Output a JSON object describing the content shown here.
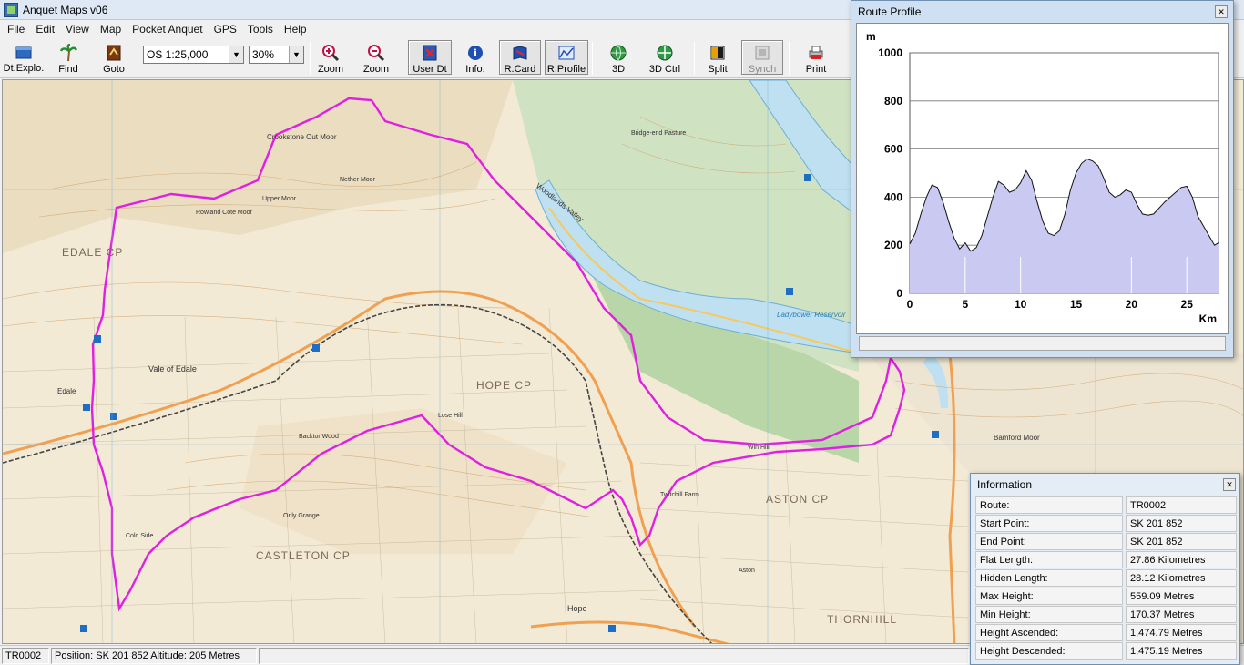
{
  "window": {
    "title": "Anquet Maps v06"
  },
  "menu": [
    "File",
    "Edit",
    "View",
    "Map",
    "Pocket Anquet",
    "GPS",
    "Tools",
    "Help"
  ],
  "toolbar": {
    "buttons": {
      "dt_explo": "Dt.Explo.",
      "find": "Find",
      "goto": "Goto",
      "zoom_in": "Zoom",
      "zoom_out": "Zoom",
      "user_dt": "User Dt",
      "info": "Info.",
      "r_card": "R.Card",
      "r_profile": "R.Profile",
      "three_d": "3D",
      "three_d_ctrl": "3D Ctrl",
      "split": "Split",
      "synch": "Synch",
      "print": "Print"
    },
    "scale_value": "OS 1:25,000",
    "zoom_value": "30%"
  },
  "map": {
    "labels": {
      "edale_cp": "EDALE CP",
      "hope_cp": "HOPE CP",
      "castleton_cp": "CASTLETON CP",
      "aston_cp": "ASTON CP",
      "thornhill": "THORNHILL",
      "crookstone": "Crookstone Out Moor",
      "vale": "Vale of Edale",
      "edale": "Edale",
      "ladybower": "Ladybower Reservoir",
      "woodlands": "Woodlands Valley",
      "bamford": "Bamford Moor",
      "hope": "Hope",
      "nether_moor": "Nether Moor",
      "upper_moor": "Upper Moor",
      "rowland": "Rowland Cote Moor",
      "cold_side": "Cold Side",
      "win_hill": "Win Hill",
      "lose_hill": "Lose Hill",
      "ladybower_res": "Ladybower Reservoir",
      "bridge_pasture": "Bridge-end Pasture",
      "backtor": "Backtor Wood",
      "only_grange": "Only Grange",
      "twitchill": "Twitchill Farm",
      "aston": "Aston"
    }
  },
  "status": {
    "route": "TR0002",
    "position": "Position: SK 201 852  Altitude: 205 Metres"
  },
  "profile_window": {
    "title": "Route Profile"
  },
  "chart_data": {
    "type": "area",
    "title": "",
    "ylabel": "m",
    "xlabel": "Km",
    "xlim": [
      0,
      27.86
    ],
    "ylim": [
      0,
      1000
    ],
    "x_ticks": [
      0,
      5,
      10,
      15,
      20,
      25
    ],
    "y_ticks": [
      0,
      200,
      400,
      600,
      800,
      1000
    ],
    "grid": "horizontal",
    "x": [
      0,
      0.5,
      1,
      1.5,
      2,
      2.5,
      3,
      3.5,
      4,
      4.5,
      5,
      5.5,
      6,
      6.5,
      7,
      7.5,
      8,
      8.5,
      9,
      9.5,
      10,
      10.5,
      11,
      11.5,
      12,
      12.5,
      13,
      13.5,
      14,
      14.5,
      15,
      15.5,
      16,
      16.5,
      17,
      17.5,
      18,
      18.5,
      19,
      19.5,
      20,
      20.5,
      21,
      21.5,
      22,
      22.5,
      23,
      23.5,
      24,
      24.5,
      25,
      25.5,
      26,
      26.5,
      27,
      27.5,
      27.86
    ],
    "values": [
      205,
      250,
      330,
      400,
      450,
      440,
      380,
      300,
      230,
      185,
      210,
      175,
      190,
      240,
      320,
      400,
      465,
      450,
      420,
      430,
      460,
      510,
      470,
      380,
      300,
      250,
      240,
      260,
      330,
      430,
      500,
      540,
      559,
      550,
      530,
      480,
      420,
      400,
      410,
      430,
      420,
      370,
      330,
      325,
      330,
      355,
      380,
      400,
      420,
      440,
      445,
      400,
      320,
      280,
      240,
      200,
      210
    ]
  },
  "info_window": {
    "title": "Information",
    "rows": [
      {
        "label": "Route:",
        "value": "TR0002"
      },
      {
        "label": "Start Point:",
        "value": "SK 201 852"
      },
      {
        "label": "End Point:",
        "value": "SK 201 852"
      },
      {
        "label": "Flat Length:",
        "value": "27.86 Kilometres"
      },
      {
        "label": "Hidden Length:",
        "value": "28.12 Kilometres"
      },
      {
        "label": "Max Height:",
        "value": "559.09 Metres"
      },
      {
        "label": "Min Height:",
        "value": "170.37 Metres"
      },
      {
        "label": "Height Ascended:",
        "value": "1,474.79 Metres"
      },
      {
        "label": "Height Descended:",
        "value": "1,475.19 Metres"
      }
    ]
  },
  "colors": {
    "route": "#e020e0",
    "profile_fill": "#c9c9f2",
    "water": "#bfe0f0",
    "road": "#f0a050",
    "rail": "#444444"
  }
}
